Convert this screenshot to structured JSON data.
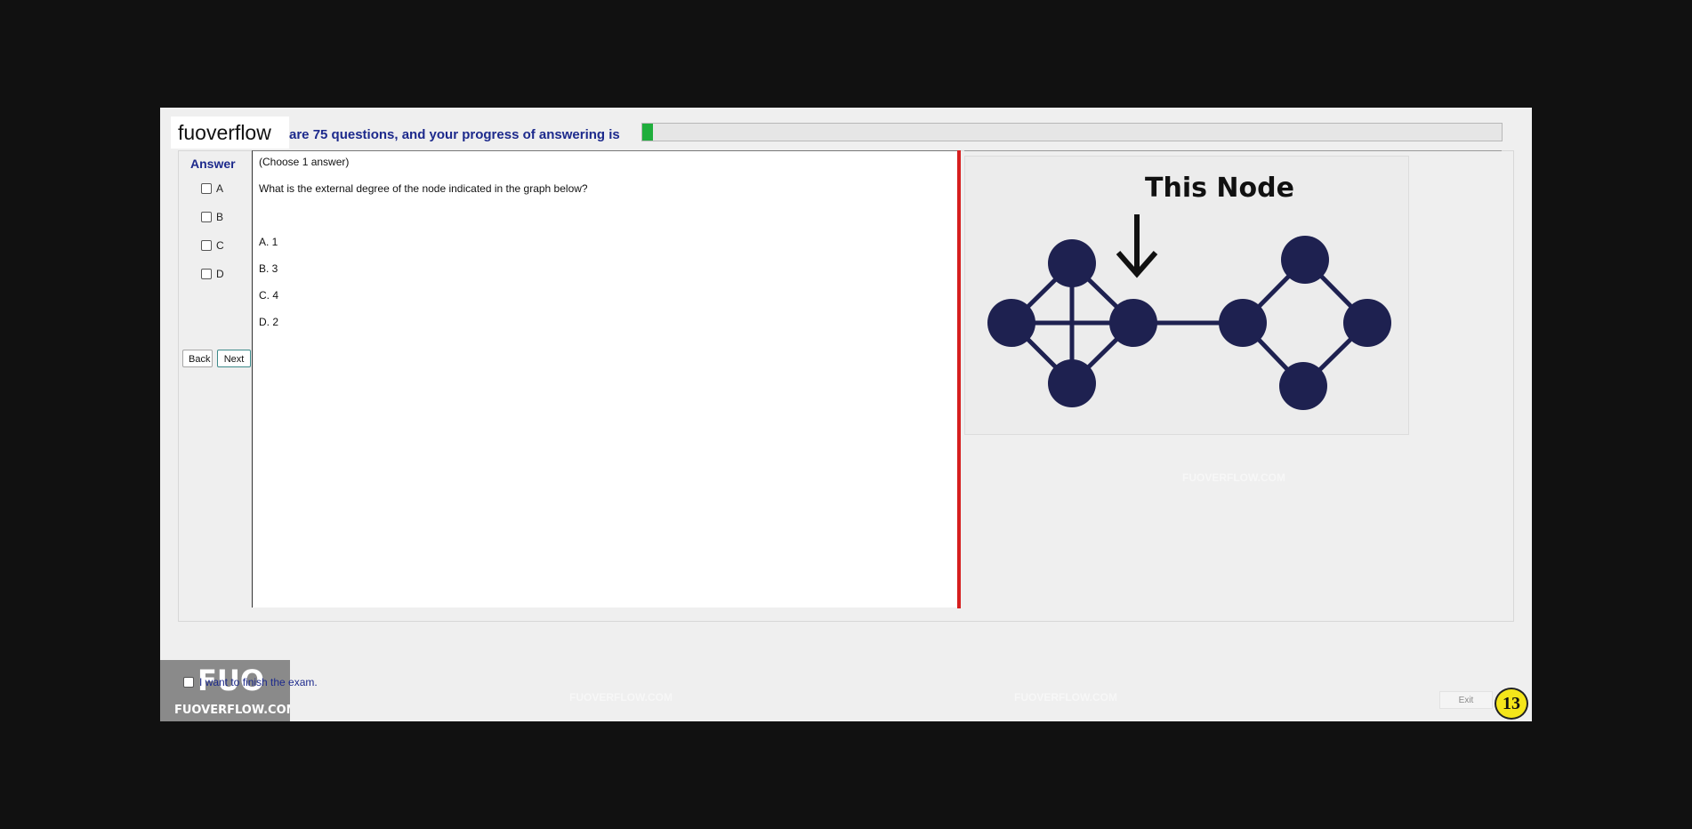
{
  "brand": {
    "text": "fuoverflow"
  },
  "progress": {
    "label": "are 75 questions, and your progress of answering is",
    "fraction": 0.012
  },
  "answer": {
    "heading": "Answer",
    "options": [
      "A",
      "B",
      "C",
      "D"
    ]
  },
  "navigation": {
    "back_label": "Back",
    "next_label": "Next"
  },
  "question": {
    "instruction": "(Choose 1 answer)",
    "text": "What is the external degree of the node indicated in the graph below?",
    "choices": [
      "A.  1",
      "B.  3",
      "C.  4",
      "D.  2"
    ]
  },
  "graph_image": {
    "caption": "This Node"
  },
  "finish": {
    "label": "I want to finish the exam."
  },
  "logo_badge": {
    "top": "FUO",
    "bottom": "FUOVERFLOW.COM"
  },
  "watermark": {
    "text": "FUOVERFLOW.COM"
  },
  "exit": {
    "label": "Exit"
  },
  "counter": {
    "value": "13"
  },
  "colors": {
    "accent_blue": "#1d2a8c",
    "progress_green": "#1fae3c",
    "divider_red": "#d61f1f",
    "node_navy": "#1e2150",
    "badge_yellow": "#f4e51a"
  }
}
